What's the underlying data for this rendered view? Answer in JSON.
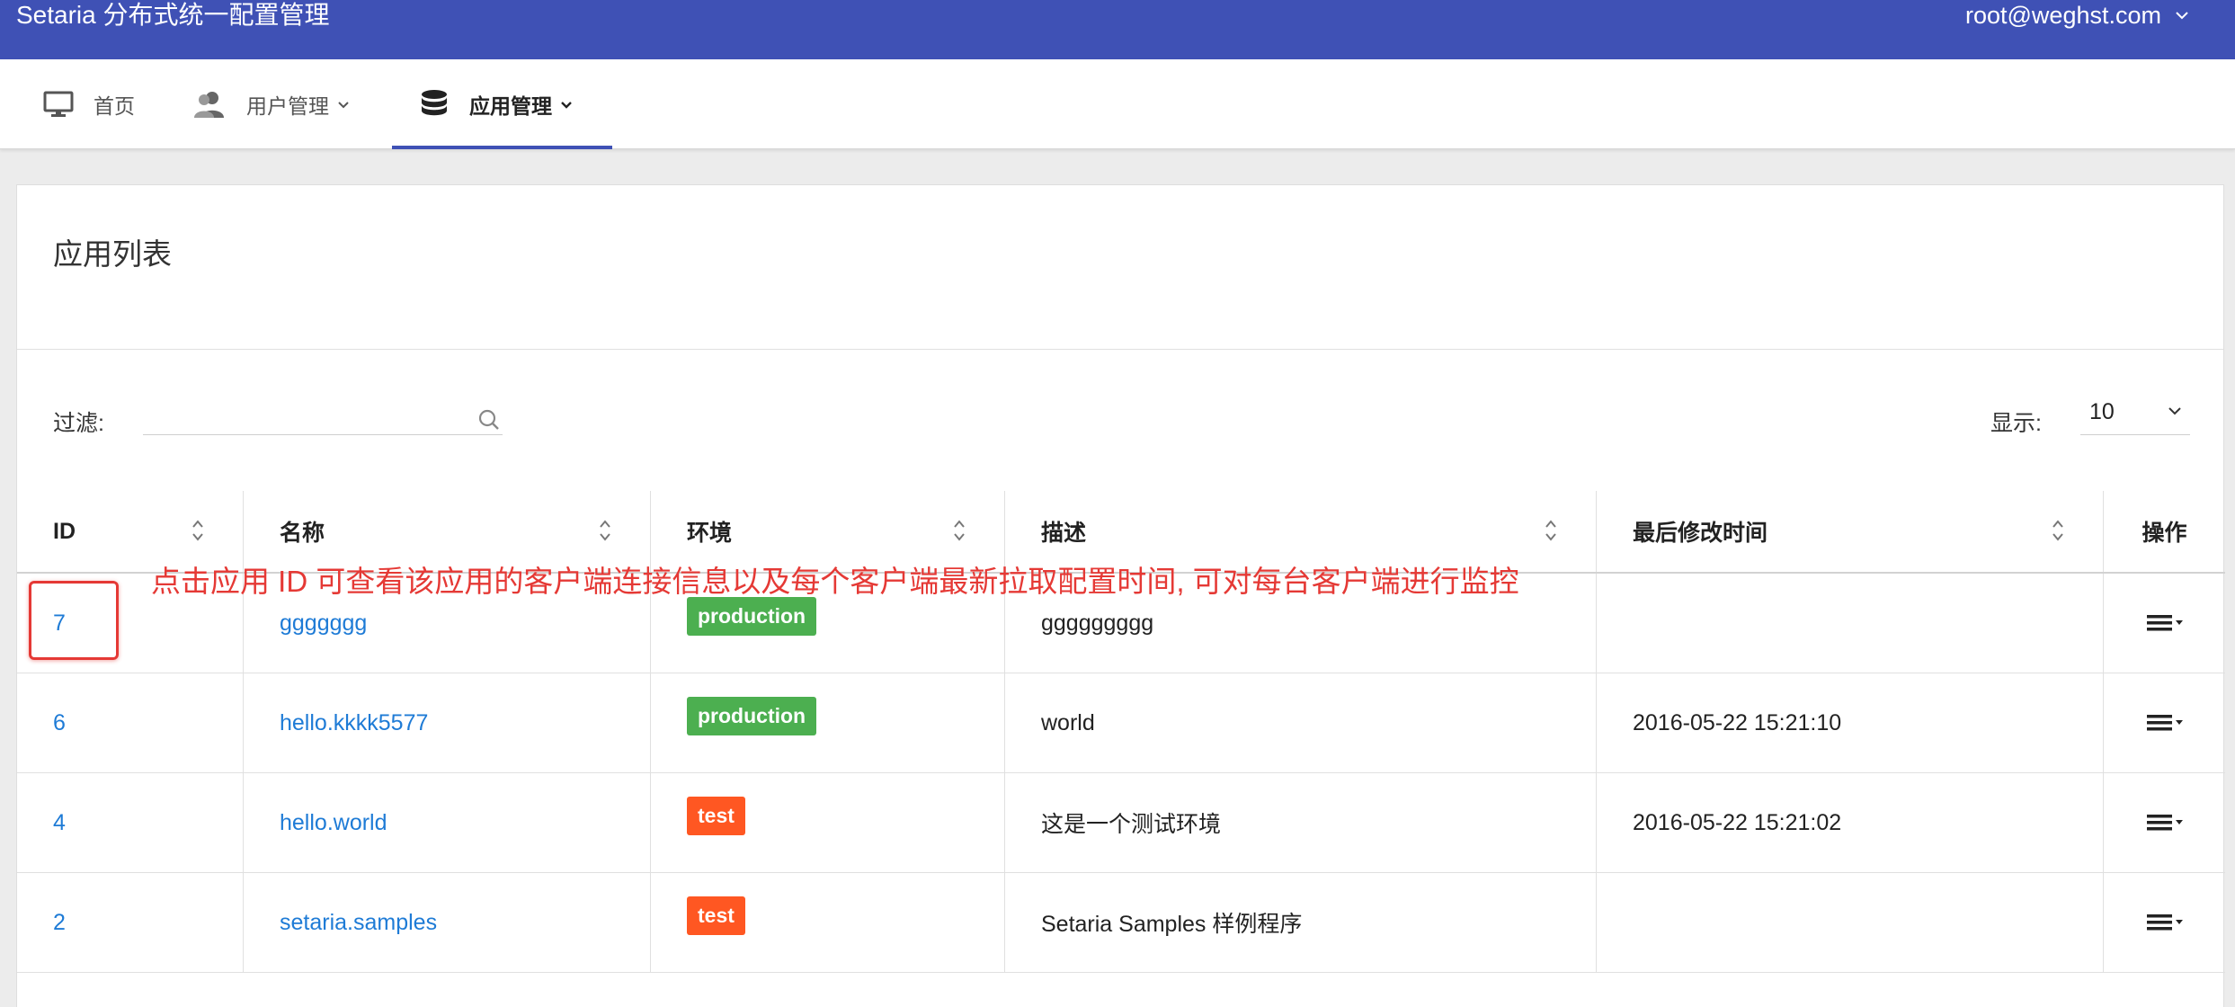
{
  "app": {
    "title": "Setaria 分布式统一配置管理",
    "user": "root@weghst.com"
  },
  "nav": [
    {
      "label": "首页",
      "icon": "monitor-icon",
      "active": false,
      "dropdown": false
    },
    {
      "label": "用户管理",
      "icon": "users-icon",
      "active": false,
      "dropdown": true
    },
    {
      "label": "应用管理",
      "icon": "database-icon",
      "active": true,
      "dropdown": true
    }
  ],
  "page": {
    "title": "应用列表",
    "filter_label": "过滤:",
    "filter_placeholder": "",
    "show_label": "显示:",
    "show_value": "10"
  },
  "table": {
    "columns": [
      "ID",
      "名称",
      "环境",
      "描述",
      "最后修改时间",
      "操作"
    ],
    "rows": [
      {
        "id": "7",
        "name": "ggggggg",
        "env": "production",
        "description": "ggggggggg",
        "modified": ""
      },
      {
        "id": "6",
        "name": "hello.kkkk5577",
        "env": "production",
        "description": "world",
        "modified": "2016-05-22 15:21:10"
      },
      {
        "id": "4",
        "name": "hello.world",
        "env": "test",
        "description": "这是一个测试环境",
        "modified": "2016-05-22 15:21:02"
      },
      {
        "id": "2",
        "name": "setaria.samples",
        "env": "test",
        "description": "Setaria Samples 样例程序",
        "modified": ""
      }
    ]
  },
  "annotation": "点击应用 ID 可查看该应用的客户端连接信息以及每个客户端最新拉取配置时间, 可对每台客户端进行监控",
  "colors": {
    "topbar": "#3f51b5",
    "link": "#1e7bd6",
    "production": "#4caf50",
    "test": "#ff5722",
    "annotation": "#e53935"
  }
}
